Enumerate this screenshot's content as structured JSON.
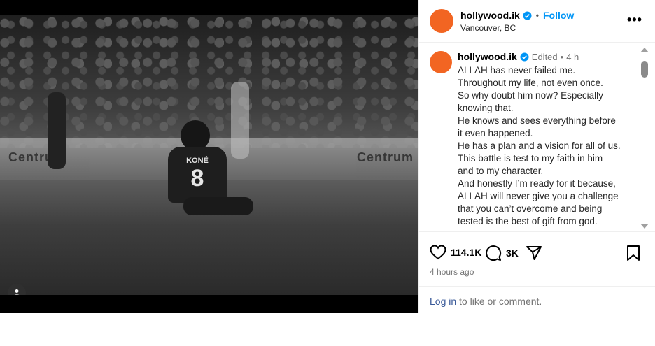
{
  "media": {
    "jersey_name": "KONÉ",
    "jersey_number": "8",
    "board_texts": [
      "Centrum",
      "Centrum"
    ],
    "profile_icon": "person-icon"
  },
  "header": {
    "username": "hollywood.ik",
    "separator": "•",
    "follow_label": "Follow",
    "location": "Vancouver, BC",
    "more_icon": "more-options-icon",
    "more_label": "•••"
  },
  "comment": {
    "username": "hollywood.ik",
    "edited": "Edited",
    "dot": "•",
    "time": "4 h",
    "lines": [
      "ALLAH has never failed me.",
      "Throughout my life, not even once.",
      "So why doubt him now? Especially",
      "knowing that.",
      "He knows and sees everything before",
      "it even happened.",
      "He has a plan and a vision for all of us.",
      "This battle is test to my faith in him",
      "and to my character.",
      "And honestly I’m ready for it because,",
      "ALLAH will never give you a challenge",
      "that you can’t overcome and being",
      "tested is the best of gift from god."
    ]
  },
  "actions": {
    "likes": "114.1K",
    "comments": "3K",
    "timestamp": "4 hours ago",
    "login_link": "Log in",
    "login_rest": " to like or comment."
  },
  "colors": {
    "avatar": "#f26522",
    "verified": "#0095f6",
    "follow": "#0095f6",
    "link": "#385898"
  }
}
